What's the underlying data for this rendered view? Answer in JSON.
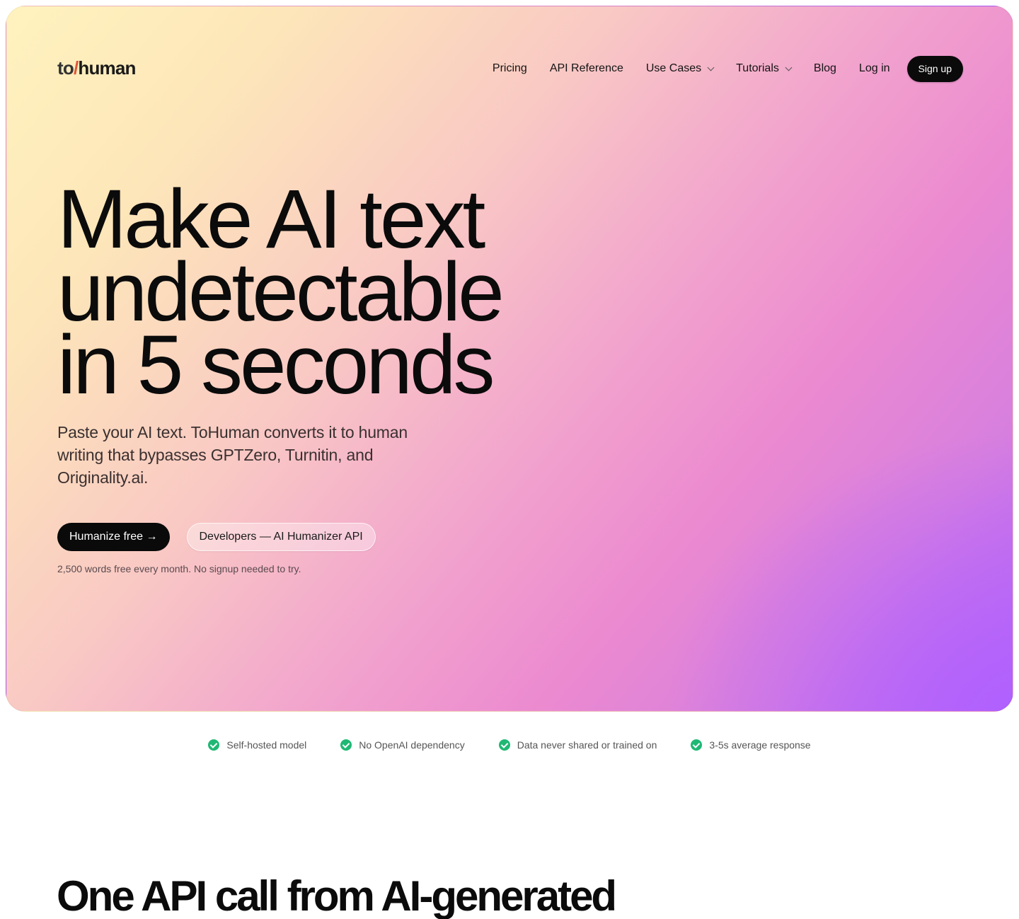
{
  "nav": {
    "logo": {
      "to": "to",
      "slash": "/",
      "human": "human"
    },
    "links": [
      {
        "label": "Pricing",
        "dropdown": false
      },
      {
        "label": "API Reference",
        "dropdown": false
      },
      {
        "label": "Use Cases",
        "dropdown": true
      },
      {
        "label": "Tutorials",
        "dropdown": true
      },
      {
        "label": "Blog",
        "dropdown": false
      },
      {
        "label": "Log in",
        "dropdown": false
      }
    ],
    "signup_label": "Sign up"
  },
  "hero": {
    "headline_lines": [
      "Make AI text",
      "undetectable",
      "in 5 seconds"
    ],
    "subhead": "Paste your AI text. ToHuman converts it to human writing that bypasses GPTZero, Turnitin, and Originality.ai.",
    "primary_cta": "Humanize free →",
    "secondary_cta": "Developers — AI Humanizer API",
    "note": "2,500 words free every month. No signup needed to try."
  },
  "features": [
    "Self-hosted model",
    "No OpenAI dependency",
    "Data never shared or trained on",
    "3-5s average response"
  ],
  "section": {
    "title": "One API call from AI-generated"
  },
  "colors": {
    "accent_check": "#1fb874",
    "button_dark": "#0a0a0a",
    "logo_slash": "#e0563a"
  }
}
